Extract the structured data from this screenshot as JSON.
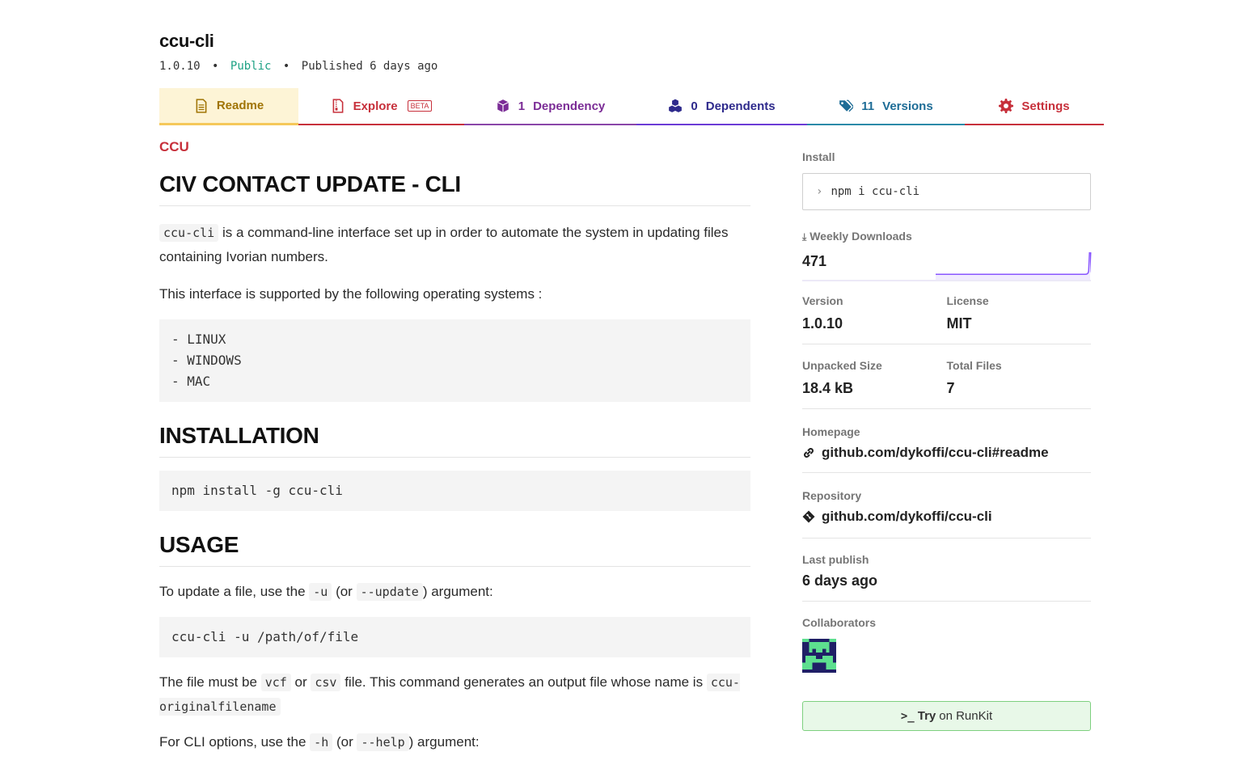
{
  "package": {
    "name": "ccu-cli",
    "version": "1.0.10",
    "visibility": "Public",
    "published": "Published 6 days ago",
    "separator": "•"
  },
  "tabs": {
    "readme": {
      "label": "Readme",
      "icon": "document-icon"
    },
    "explore": {
      "label": "Explore",
      "badge": "BETA",
      "icon": "file-zip-icon"
    },
    "dependency": {
      "count": "1",
      "label": "Dependency",
      "icon": "box-icon"
    },
    "dependents": {
      "count": "0",
      "label": "Dependents",
      "icon": "boxes-icon"
    },
    "versions": {
      "count": "11",
      "label": "Versions",
      "icon": "tags-icon"
    },
    "settings": {
      "label": "Settings",
      "icon": "gear-icon"
    }
  },
  "readme": {
    "link": "CCU",
    "title": "CIV CONTACT UPDATE - CLI",
    "intro_code": "ccu-cli",
    "intro_text": "is a command-line interface set up in order to automate the system in updating files containing Ivorian numbers.",
    "os_intro": "This interface is supported by the following operating systems :",
    "os_list": [
      "- LINUX",
      "- WINDOWS",
      "- MAC"
    ],
    "installation_heading": "INSTALLATION",
    "install_command": "npm install -g ccu-cli",
    "usage_heading": "USAGE",
    "update_text_1": "To update a file, use the",
    "update_flag_short": "-u",
    "update_text_2": "(or",
    "update_flag_long": "--update",
    "update_text_3": ") argument:",
    "update_command": "ccu-cli -u /path/of/file",
    "file_text_1": "The file must be",
    "file_type_1": "vcf",
    "file_text_2": "or",
    "file_type_2": "csv",
    "file_text_3": "file. This command generates an output file whose name is",
    "file_output": "ccu-originalfilename",
    "help_text_1": "For CLI options, use the",
    "help_flag_short": "-h",
    "help_text_2": "(or",
    "help_flag_long": "--help",
    "help_text_3": ") argument:"
  },
  "sidebar": {
    "install_label": "Install",
    "install_command": "npm i ccu-cli",
    "downloads_label": "Weekly Downloads",
    "downloads_value": "471",
    "version_label": "Version",
    "version_value": "1.0.10",
    "license_label": "License",
    "license_value": "MIT",
    "size_label": "Unpacked Size",
    "size_value": "18.4 kB",
    "files_label": "Total Files",
    "files_value": "7",
    "homepage_label": "Homepage",
    "homepage_value": "github.com/dykoffi/ccu-cli#readme",
    "repository_label": "Repository",
    "repository_value": "github.com/dykoffi/ccu-cli",
    "last_publish_label": "Last publish",
    "last_publish_value": "6 days ago",
    "collaborators_label": "Collaborators",
    "runkit_try": "Try",
    "runkit_rest": "on RunKit"
  },
  "colors": {
    "readme_accent": "#f5c85a",
    "explore": "#c7303b",
    "dependency": "#8a46a8",
    "dependents": "#6b3bd6",
    "versions": "#2b8aa8",
    "settings": "#c7303b",
    "public": "#1da184",
    "sparkline": "#8956ff",
    "runkit_bg": "#e8f8e8"
  }
}
